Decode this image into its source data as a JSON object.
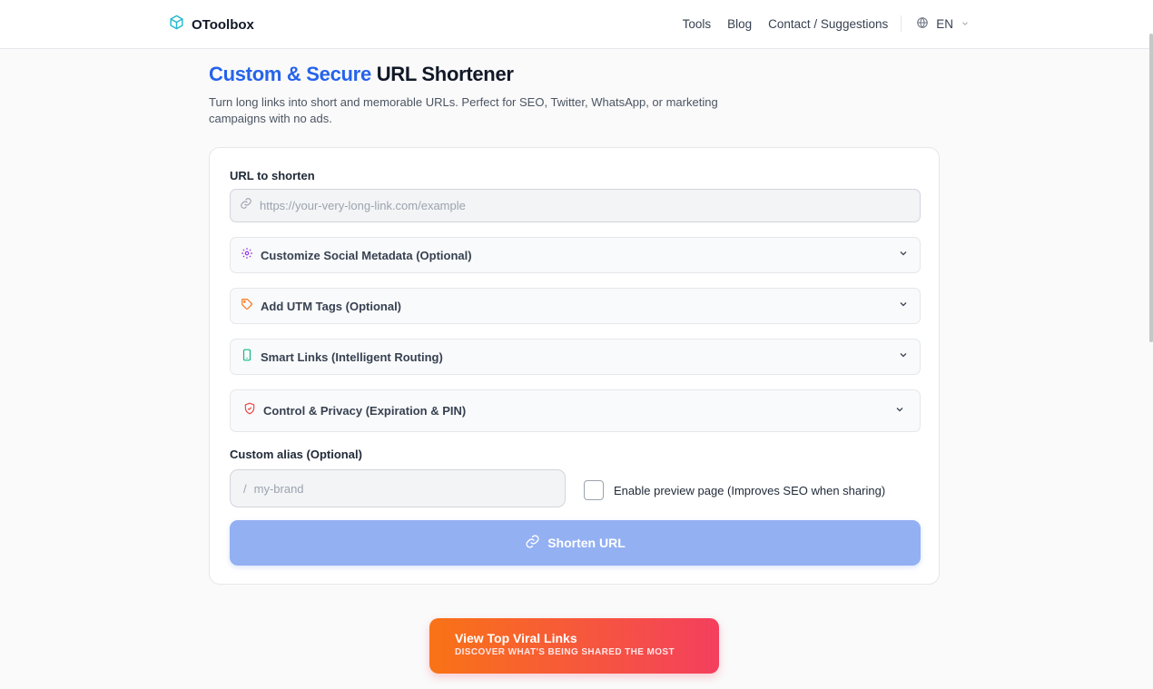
{
  "header": {
    "brand": "OToolbox",
    "nav": [
      "Tools",
      "Blog",
      "Contact / Suggestions"
    ],
    "language": "EN"
  },
  "hero": {
    "title_accent": "Custom & Secure",
    "title_rest": " URL Shortener",
    "subtitle": "Turn long links into short and memorable URLs. Perfect for SEO, Twitter, WhatsApp, or marketing campaigns with no ads."
  },
  "form": {
    "url_label": "URL to shorten",
    "url_placeholder": "https://your-very-long-link.com/example",
    "sections": [
      {
        "label": "Customize Social Metadata (Optional)",
        "icon": "gear-icon",
        "color": "#9333ea"
      },
      {
        "label": "Add UTM Tags (Optional)",
        "icon": "tag-icon",
        "color": "#f97316"
      },
      {
        "label": "Smart Links (Intelligent Routing)",
        "icon": "smartphone-icon",
        "color": "#10b981"
      },
      {
        "label": "Control & Privacy (Expiration & PIN)",
        "icon": "shield-icon",
        "color": "#ef4444"
      }
    ],
    "alias_label": "Custom alias (Optional)",
    "alias_prefix": "/",
    "alias_placeholder": "my-brand",
    "preview_label": "Enable preview page (Improves SEO when sharing)",
    "preview_checked": false,
    "submit_label": "Shorten URL"
  },
  "viral": {
    "title": "View Top Viral Links",
    "subtitle": "DISCOVER WHAT'S BEING SHARED THE MOST"
  },
  "colors": {
    "accent": "#2563eb",
    "submit": "#93b0f2",
    "viral_start": "#f97316",
    "viral_end": "#f43f5e"
  }
}
